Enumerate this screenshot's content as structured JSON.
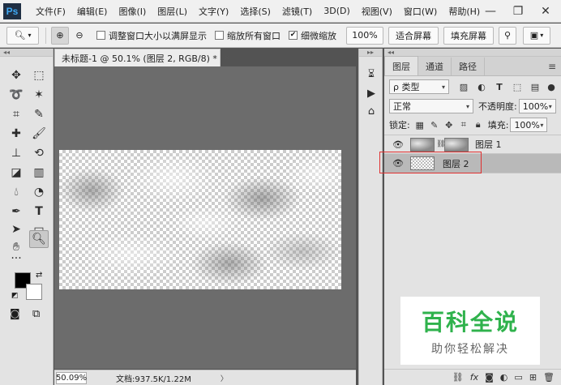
{
  "app": {
    "logo": "Ps"
  },
  "menu": [
    "文件(F)",
    "编辑(E)",
    "图像(I)",
    "图层(L)",
    "文字(Y)",
    "选择(S)",
    "滤镜(T)",
    "3D(D)",
    "视图(V)",
    "窗口(W)",
    "帮助(H)"
  ],
  "window_controls": {
    "minimize": "—",
    "restore": "❐",
    "close": "✕"
  },
  "options": {
    "resize_windows_label": "调整窗口大小以满屏显示",
    "zoom_all_label": "缩放所有窗口",
    "scrubby_zoom_label": "细微缩放",
    "zoom_value": "100%",
    "fit_screen_label": "适合屏幕",
    "fill_screen_label": "填充屏幕",
    "resize_checked": false,
    "zoom_all_checked": false,
    "scrubby_checked": true
  },
  "document": {
    "tab_title": "未标题-1 @ 50.1% (图层 2, RGB/8) *",
    "tab_close": "×",
    "zoom": "50.09%",
    "doc_size": "文档:937.5K/1.22M",
    "status_arrow": "〉"
  },
  "tools": {
    "foreground_color": "#000000",
    "background_color": "#ffffff"
  },
  "layers_panel": {
    "tabs": [
      "图层",
      "通道",
      "路径"
    ],
    "active_tab": "图层",
    "filter_label": "ρ 类型",
    "blend_mode": "正常",
    "opacity_label": "不透明度:",
    "opacity_value": "100%",
    "lock_label": "锁定:",
    "fill_label": "填充:",
    "fill_value": "100%",
    "layers": [
      {
        "name": "图层 1",
        "visible": true,
        "selected": false
      },
      {
        "name": "图层 2",
        "visible": true,
        "selected": true
      }
    ]
  },
  "watermark": {
    "title": "百科全说",
    "subtitle": "助你轻松解决"
  }
}
